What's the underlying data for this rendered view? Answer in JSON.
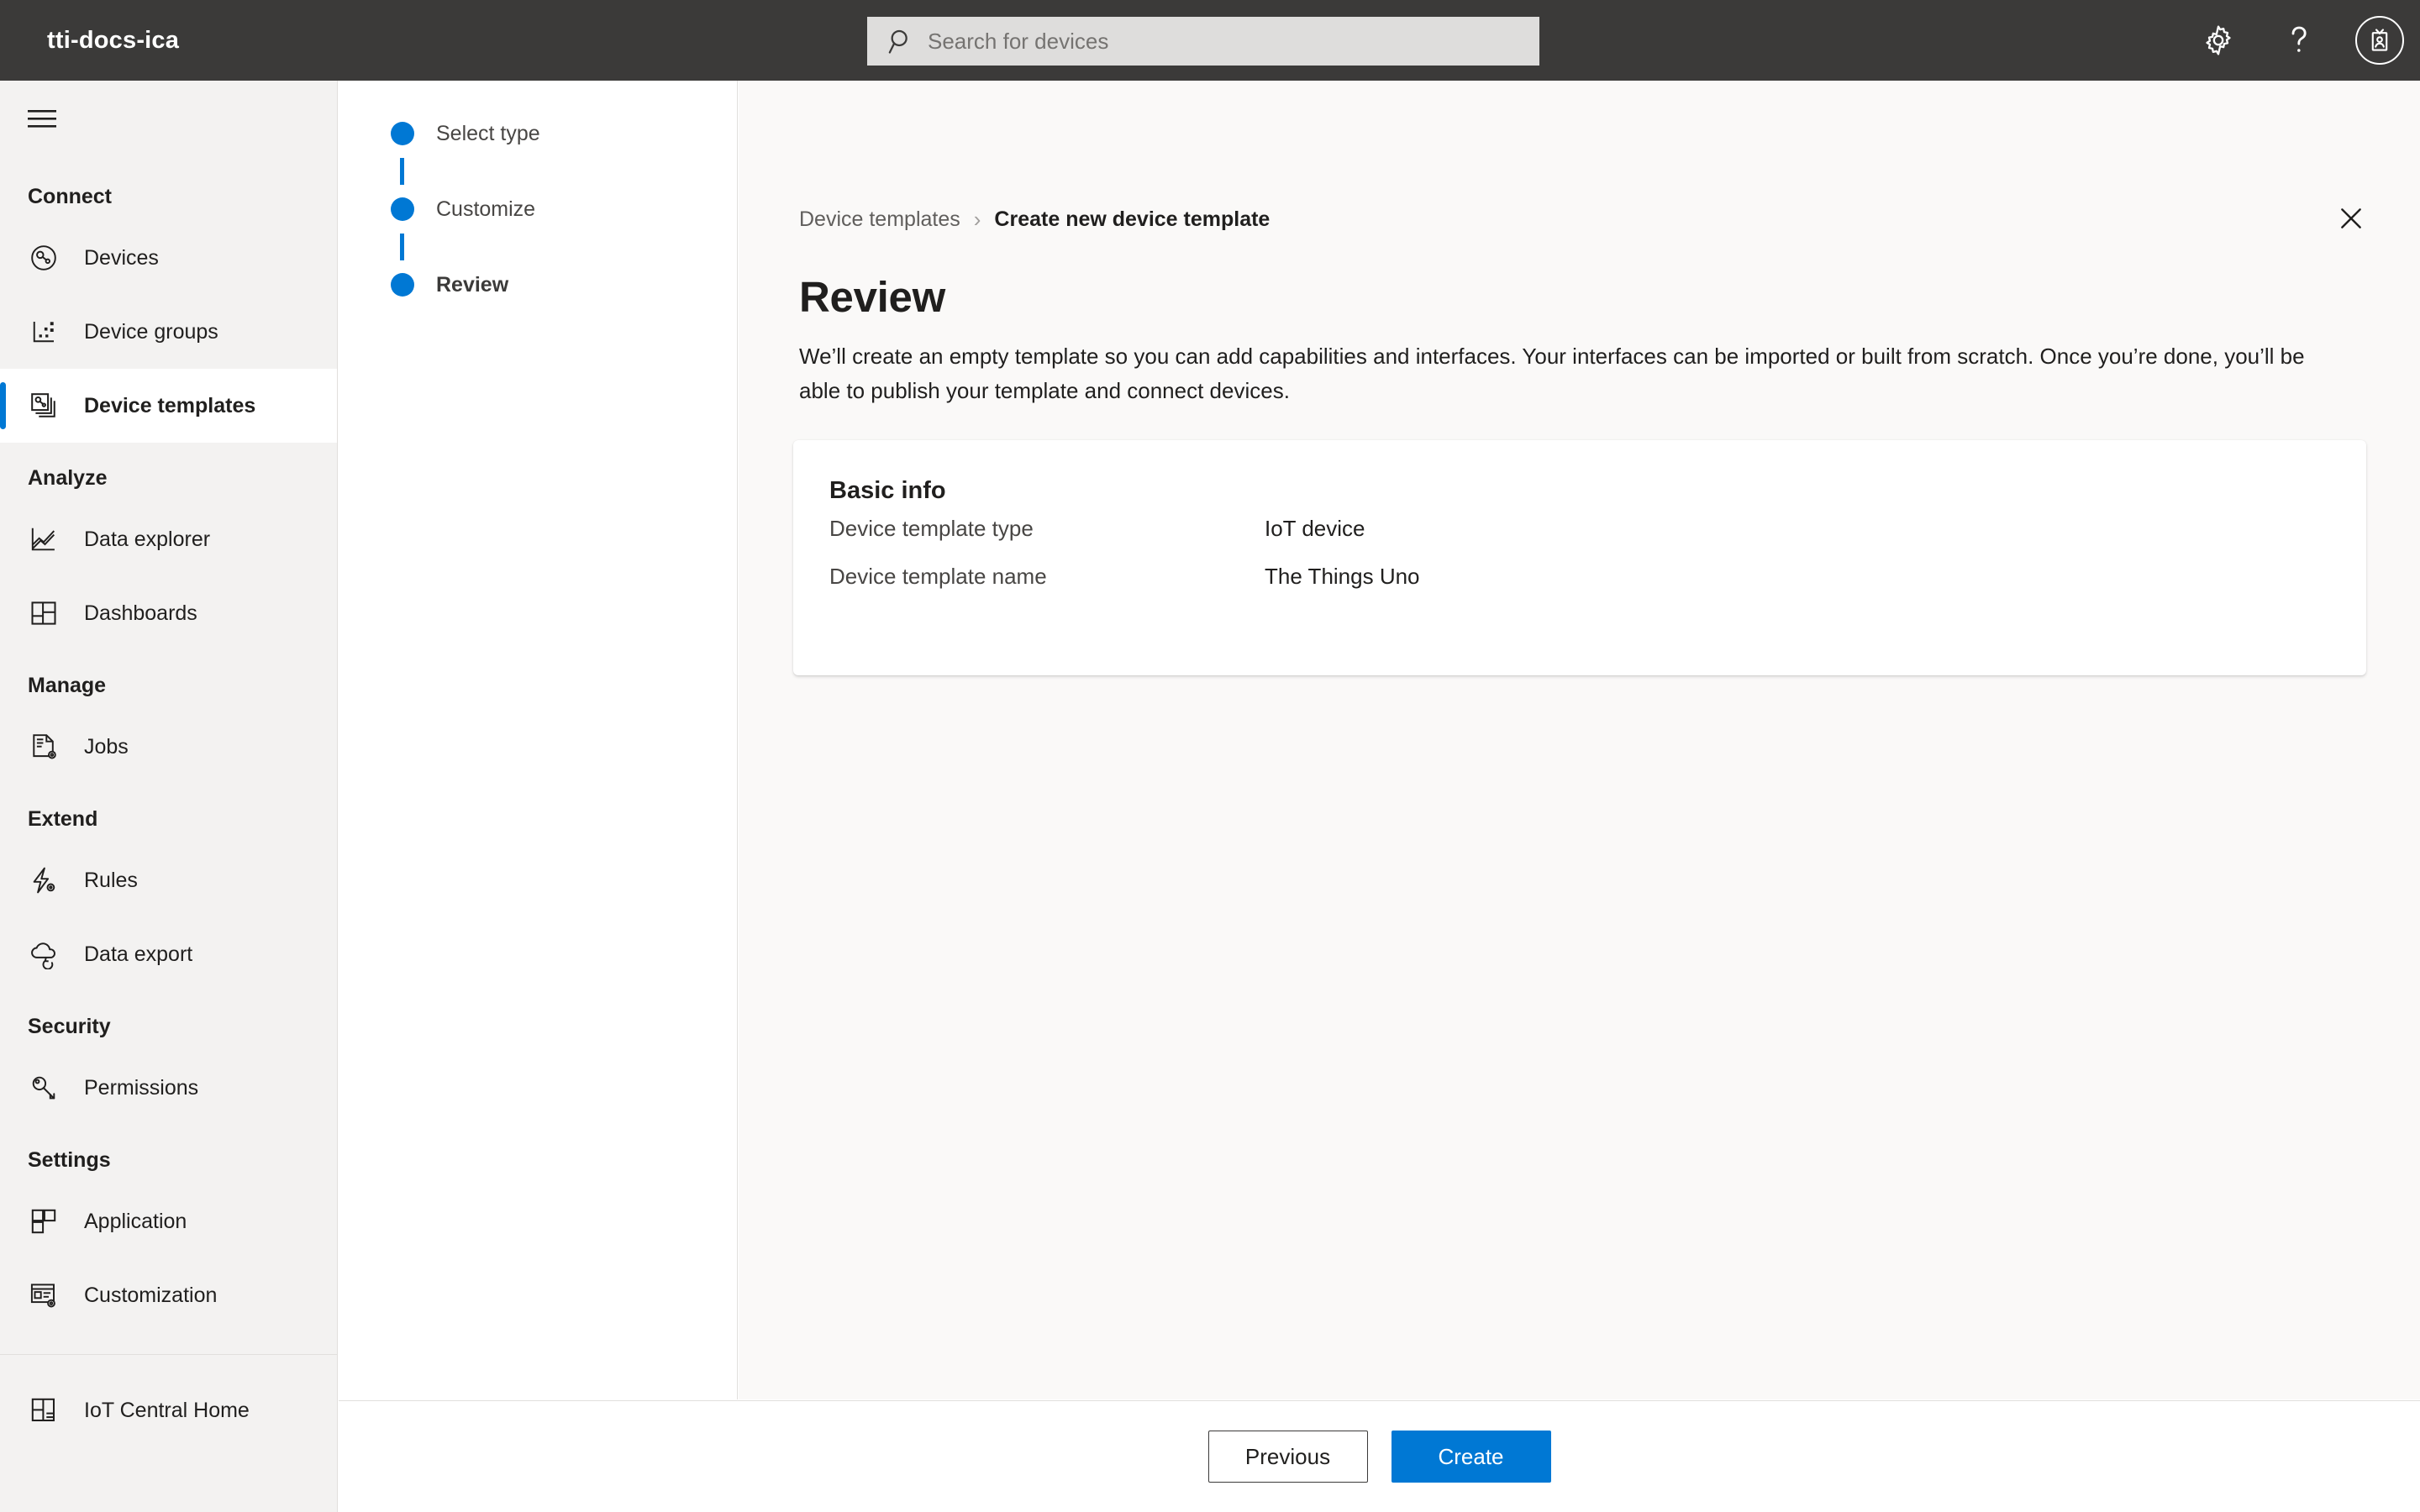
{
  "topbar": {
    "app_title": "tti-docs-ica",
    "search": {
      "placeholder": "Search for devices",
      "value": ""
    },
    "settings_label": "Settings",
    "help_label": "Help",
    "account_label": "Account"
  },
  "sidebar": {
    "menu_label": "Menu",
    "sections": [
      {
        "title": "Connect",
        "items": [
          {
            "label": "Devices",
            "icon": "devices-icon",
            "selected": false
          },
          {
            "label": "Device groups",
            "icon": "device-groups-icon",
            "selected": false
          },
          {
            "label": "Device templates",
            "icon": "device-templates-icon",
            "selected": true
          }
        ]
      },
      {
        "title": "Analyze",
        "items": [
          {
            "label": "Data explorer",
            "icon": "data-explorer-icon",
            "selected": false
          },
          {
            "label": "Dashboards",
            "icon": "dashboards-icon",
            "selected": false
          }
        ]
      },
      {
        "title": "Manage",
        "items": [
          {
            "label": "Jobs",
            "icon": "jobs-icon",
            "selected": false
          }
        ]
      },
      {
        "title": "Extend",
        "items": [
          {
            "label": "Rules",
            "icon": "rules-icon",
            "selected": false
          },
          {
            "label": "Data export",
            "icon": "data-export-icon",
            "selected": false
          }
        ]
      },
      {
        "title": "Security",
        "items": [
          {
            "label": "Permissions",
            "icon": "permissions-key-icon",
            "selected": false
          }
        ]
      },
      {
        "title": "Settings",
        "items": [
          {
            "label": "Application",
            "icon": "application-icon",
            "selected": false
          },
          {
            "label": "Customization",
            "icon": "customization-icon",
            "selected": false
          }
        ]
      }
    ],
    "footer_item": {
      "label": "IoT Central Home",
      "icon": "iot-central-home-icon"
    }
  },
  "wizard": {
    "steps": [
      {
        "label": "Select type",
        "active": false
      },
      {
        "label": "Customize",
        "active": false
      },
      {
        "label": "Review",
        "active": true
      }
    ]
  },
  "breadcrumb": {
    "parent": "Device templates",
    "separator": "›",
    "current": "Create new device template"
  },
  "main": {
    "close_label": "Close",
    "title": "Review",
    "description": "We’ll create an empty template so you can add capabilities and interfaces. Your interfaces can be imported or built from scratch. Once you’re done, you’ll be able to publish your template and connect devices.",
    "card": {
      "title": "Basic info",
      "rows": [
        {
          "key": "Device template type",
          "value": "IoT device"
        },
        {
          "key": "Device template name",
          "value": "The Things Uno"
        }
      ]
    }
  },
  "footer": {
    "previous_label": "Previous",
    "create_label": "Create"
  },
  "colors": {
    "topbar_bg": "#3b3a39",
    "sidebar_bg": "#f3f2f1",
    "content_bg": "#faf9f8",
    "accent": "#0078d4",
    "text_primary": "#201f1e",
    "text_secondary": "#605e5c",
    "border": "#e1dfdd"
  }
}
